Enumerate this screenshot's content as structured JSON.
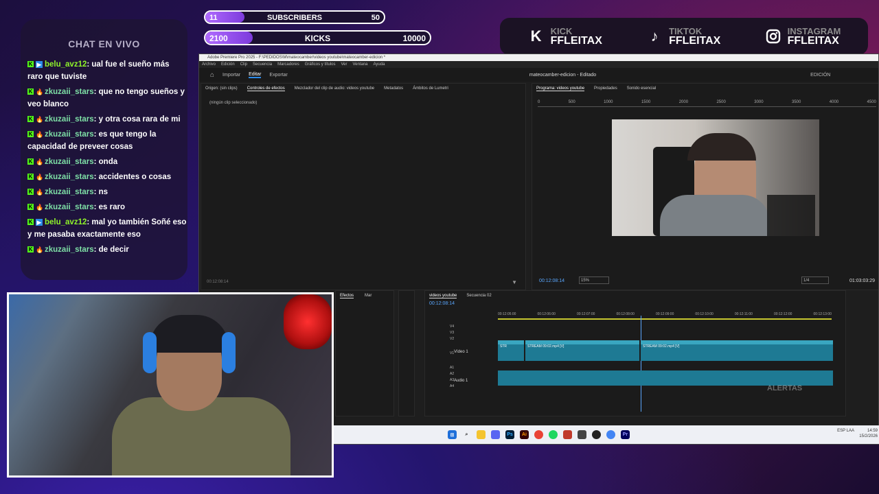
{
  "goals": {
    "subs": {
      "current": "11",
      "label": "SUBSCRIBERS",
      "target": "50",
      "progress": 0.22
    },
    "kicks": {
      "current": "2100",
      "label": "KICKS",
      "target": "10000",
      "progress": 0.21
    }
  },
  "socials": [
    {
      "icon": "kick-icon",
      "platform": "KICK",
      "handle": "FFLEITAX"
    },
    {
      "icon": "tiktok-icon",
      "platform": "TIKTOK",
      "handle": "FFLEITAX"
    },
    {
      "icon": "instagram-icon",
      "platform": "INSTAGRAM",
      "handle": "FFLEITAX"
    }
  ],
  "chat": {
    "title": "CHAT EN VIVO",
    "messages": [
      {
        "user": "belu_avz12",
        "badge": "blue",
        "text": "ual fue el sueño más raro que tuviste"
      },
      {
        "user": "zkuzaii_stars",
        "badge": "fire",
        "text": "que no tengo sueños y veo blanco"
      },
      {
        "user": "zkuzaii_stars",
        "badge": "fire",
        "text": "y otra cosa rara de mi"
      },
      {
        "user": "zkuzaii_stars",
        "badge": "fire",
        "text": "es que tengo la capacidad de preveer cosas"
      },
      {
        "user": "zkuzaii_stars",
        "badge": "fire",
        "text": "onda"
      },
      {
        "user": "zkuzaii_stars",
        "badge": "fire",
        "text": "accidentes o cosas"
      },
      {
        "user": "zkuzaii_stars",
        "badge": "fire",
        "text": "ns"
      },
      {
        "user": "zkuzaii_stars",
        "badge": "fire",
        "text": "es raro"
      },
      {
        "user": "belu_avz12",
        "badge": "blue",
        "text": "mal yo también Soñé eso y me pasaba exactamente eso"
      },
      {
        "user": "zkuzaii_stars",
        "badge": "fire",
        "text": "de decir"
      }
    ]
  },
  "premiere": {
    "title": "Adobe Premiere Pro 2025 - F:\\PEDIDOS\\M\\mateocamber\\videos youtube\\mateocamber-edicion *",
    "menu": [
      "Archivo",
      "Edición",
      "Clip",
      "Secuencia",
      "Marcadores",
      "Gráficos y títulos",
      "Ver",
      "Ventana",
      "Ayuda"
    ],
    "header": {
      "home": "⌂",
      "import": "Importar",
      "edit": "Editar",
      "export": "Exportar",
      "project": "mateocamber-edicion - Editado",
      "workspace": "EDICIÓN"
    },
    "source_tabs": [
      "Origen: (sin clips)",
      "Controles de efectos",
      "Mezclador del clip de audio: videos youtube",
      "Metadatos",
      "Ámbitos de Lumetri"
    ],
    "no_clip": "(ningún clip seleccionado)",
    "src_time": "00:12:08:14",
    "program_tabs": [
      "Programa: videos youtube",
      "Propiedades",
      "Sonido esencial"
    ],
    "ruler": [
      "0",
      "500",
      "1000",
      "1500",
      "2000",
      "2500",
      "3000",
      "3500",
      "4000",
      "4500"
    ],
    "timecode": "00:12:08:14",
    "zoom": "15%",
    "quality": "1/4",
    "duration": "01:03:03:29",
    "fx_tabs": [
      "Efectos",
      "Mar"
    ],
    "timeline_tabs": [
      "videos youtube",
      "Secuencia 02"
    ],
    "tl_time": "00:12:08:14",
    "tl_ruler": [
      "00:12:05:00",
      "00:12:06:00",
      "00:12:07:00",
      "00:12:08:00",
      "00:12:09:00",
      "00:12:10:00",
      "00:12:11:00",
      "00:12:12:00",
      "00:12:13:00"
    ],
    "tracks": [
      "V4",
      "V3",
      "V2",
      "V1",
      "A1",
      "A2",
      "A3",
      "A4"
    ],
    "v1_name": "Vídeo 1",
    "a1_name": "Audio 1",
    "clips": [
      "STR",
      "STREAM 09:02.mp4 [V]",
      "STREAM 09:02.mp4 [V]"
    ],
    "alerts": "ALERTAS"
  },
  "taskbar": {
    "lang": "ESP LAA",
    "time": "14:59",
    "date": "15/2/2026"
  }
}
